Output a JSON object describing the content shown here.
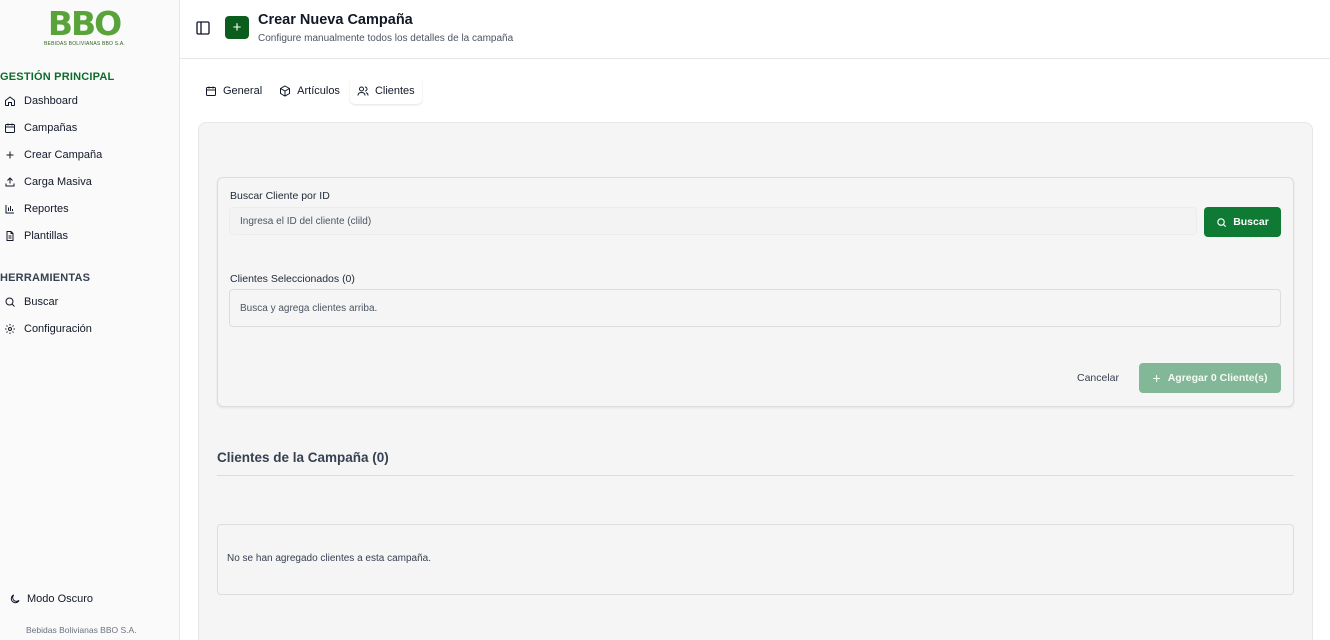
{
  "brand": {
    "logo_text": "BBO",
    "logo_subtitle": "BEBIDAS BOLIVIANAS BBO S.A.",
    "color_primary": "#0e7a33",
    "color_logo": "#5aa33a"
  },
  "sidebar": {
    "section_main": "GESTIÓN PRINCIPAL",
    "items_main": [
      {
        "label": "Dashboard",
        "icon": "home-icon"
      },
      {
        "label": "Campañas",
        "icon": "calendar-icon"
      },
      {
        "label": "Crear Campaña",
        "icon": "plus-icon"
      },
      {
        "label": "Carga Masiva",
        "icon": "upload-icon"
      },
      {
        "label": "Reportes",
        "icon": "bar-chart-icon"
      },
      {
        "label": "Plantillas",
        "icon": "file-text-icon"
      }
    ],
    "section_tools": "HERRAMIENTAS",
    "items_tools": [
      {
        "label": "Buscar",
        "icon": "search-icon"
      },
      {
        "label": "Configuración",
        "icon": "gear-icon"
      }
    ],
    "dark_mode_label": "Modo Oscuro",
    "footer": "Bebidas Bolivianas BBO S.A."
  },
  "header": {
    "badge_icon": "+",
    "title": "Crear Nueva Campaña",
    "subtitle": "Configure manualmente todos los detalles de la campaña"
  },
  "tabs": [
    {
      "label": "General",
      "icon": "calendar-icon",
      "active": false
    },
    {
      "label": "Artículos",
      "icon": "package-icon",
      "active": false
    },
    {
      "label": "Clientes",
      "icon": "users-icon",
      "active": true
    }
  ],
  "search": {
    "label": "Buscar Cliente por ID",
    "placeholder": "Ingresa el ID del cliente (clild)",
    "button_label": "Buscar",
    "selected_label": "Clientes Seleccionados (0)",
    "selected_empty": "Busca y agrega clientes arriba.",
    "cancel_label": "Cancelar",
    "add_label": "Agregar 0 Cliente(s)"
  },
  "campaign_clients": {
    "title": "Clientes de la Campaña (0)",
    "empty_text": "No se han agregado clientes a esta campaña."
  }
}
